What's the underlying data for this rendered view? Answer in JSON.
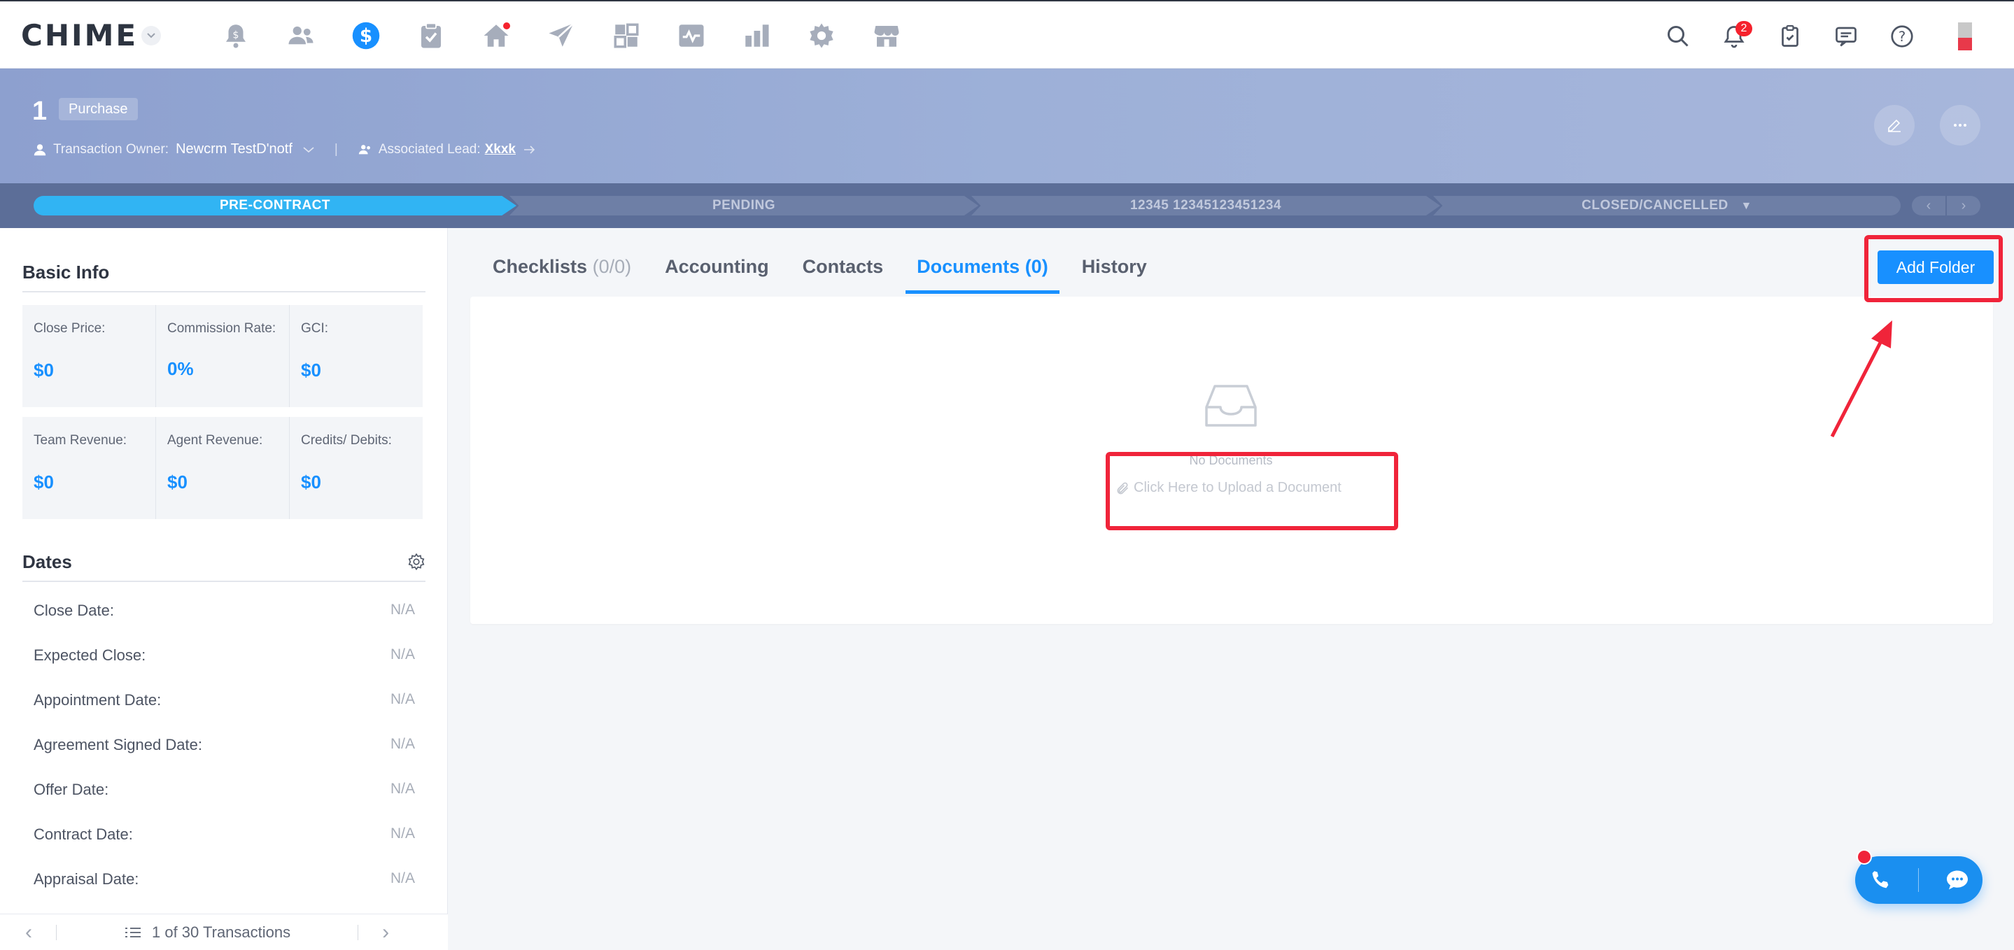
{
  "brand": {
    "logo_text": "CHIME"
  },
  "nav": {
    "icons": [
      "bell-dollar-icon",
      "people-icon",
      "dollar-circle-icon",
      "clipboard-icon",
      "home-icon",
      "send-icon",
      "dashboard-icon",
      "activity-icon",
      "bar-chart-icon",
      "gear-icon",
      "store-icon"
    ],
    "active": "dollar-circle-icon",
    "notification_count": "2"
  },
  "header": {
    "transaction_number": "1",
    "transaction_type": "Purchase",
    "owner_label": "Transaction Owner:",
    "owner_value": "Newcrm TestD'notf",
    "separator": "|",
    "lead_label": "Associated Lead:",
    "lead_value": "Xkxk"
  },
  "stages": [
    {
      "label": "PRE-CONTRACT",
      "active": true
    },
    {
      "label": "PENDING",
      "active": false
    },
    {
      "label": "12345 12345123451234",
      "active": false
    },
    {
      "label": "CLOSED/CANCELLED",
      "active": false
    }
  ],
  "basic_info": {
    "title": "Basic Info",
    "row1": [
      {
        "label": "Close Price:",
        "value": "$0"
      },
      {
        "label": "Commission Rate:",
        "value": "0%"
      },
      {
        "label": "GCI:",
        "value": "$0"
      }
    ],
    "row2": [
      {
        "label": "Team Revenue:",
        "value": "$0"
      },
      {
        "label": "Agent Revenue:",
        "value": "$0"
      },
      {
        "label": "Credits/ Debits:",
        "value": "$0"
      }
    ]
  },
  "dates": {
    "title": "Dates",
    "rows": [
      {
        "label": "Close Date:",
        "value": "N/A"
      },
      {
        "label": "Expected Close:",
        "value": "N/A"
      },
      {
        "label": "Appointment Date:",
        "value": "N/A"
      },
      {
        "label": "Agreement Signed Date:",
        "value": "N/A"
      },
      {
        "label": "Offer Date:",
        "value": "N/A"
      },
      {
        "label": "Contract Date:",
        "value": "N/A"
      },
      {
        "label": "Appraisal Date:",
        "value": "N/A"
      }
    ]
  },
  "pager": {
    "label": "1 of 30 Transactions"
  },
  "tabs": [
    {
      "label": "Checklists",
      "count": "(0/0)"
    },
    {
      "label": "Accounting",
      "count": ""
    },
    {
      "label": "Contacts",
      "count": ""
    },
    {
      "label": "Documents",
      "count": "(0)"
    },
    {
      "label": "History",
      "count": ""
    }
  ],
  "active_tab": "Documents",
  "documents": {
    "add_folder_label": "Add Folder",
    "empty_title": "No Documents",
    "upload_label": "Click Here to Upload a Document"
  },
  "colors": {
    "accent": "#1890ff",
    "stage_active": "#31b4f3",
    "annotation": "#f0243a",
    "header_band": "#9aabd6"
  }
}
